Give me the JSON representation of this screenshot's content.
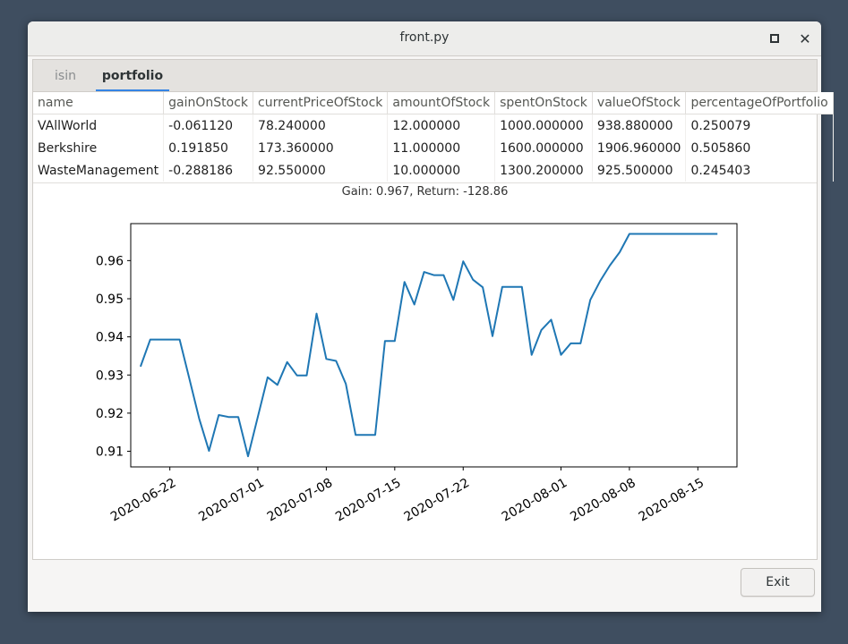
{
  "window": {
    "title": "front.py"
  },
  "tabs": [
    {
      "label": "isin",
      "active": false
    },
    {
      "label": "portfolio",
      "active": true
    }
  ],
  "table": {
    "columns": [
      "name",
      "gainOnStock",
      "currentPriceOfStock",
      "amountOfStock",
      "spentOnStock",
      "valueOfStock",
      "percentageOfPortfolio"
    ],
    "rows": [
      [
        "VAllWorld",
        "-0.061120",
        "78.240000",
        "12.000000",
        "1000.000000",
        "938.880000",
        "0.250079"
      ],
      [
        "Berkshire",
        "0.191850",
        "173.360000",
        "11.000000",
        "1600.000000",
        "1906.960000",
        "0.505860"
      ],
      [
        "WasteManagement",
        "-0.288186",
        "92.550000",
        "10.000000",
        "1300.200000",
        "925.500000",
        "0.245403"
      ]
    ]
  },
  "chart_title": "Gain: 0.967, Return: -128.86",
  "buttons": {
    "exit": "Exit"
  },
  "chart_data": {
    "type": "line",
    "title": "Gain: 0.967, Return: -128.86",
    "xlabel": "",
    "ylabel": "",
    "x_start": "2020-06-18",
    "x_end": "2020-08-19",
    "y_range": [
      0.9059,
      0.9697
    ],
    "grid": false,
    "line_color": "#1f77b4",
    "x_ticks": [
      "2020-06-22",
      "2020-07-01",
      "2020-07-08",
      "2020-07-15",
      "2020-07-22",
      "2020-08-01",
      "2020-08-08",
      "2020-08-15"
    ],
    "y_ticks": [
      0.91,
      0.92,
      0.93,
      0.94,
      0.95,
      0.96
    ],
    "series": [
      {
        "points": [
          [
            "2020-06-19",
            0.9322
          ],
          [
            "2020-06-20",
            0.9393
          ],
          [
            "2020-06-21",
            0.9393
          ],
          [
            "2020-06-22",
            0.9393
          ],
          [
            "2020-06-23",
            0.9393
          ],
          [
            "2020-06-24",
            0.929
          ],
          [
            "2020-06-25",
            0.9186
          ],
          [
            "2020-06-26",
            0.9101
          ],
          [
            "2020-06-27",
            0.9195
          ],
          [
            "2020-06-28",
            0.919
          ],
          [
            "2020-06-29",
            0.919
          ],
          [
            "2020-06-30",
            0.9087
          ],
          [
            "2020-07-01",
            0.9191
          ],
          [
            "2020-07-02",
            0.9294
          ],
          [
            "2020-07-03",
            0.9274
          ],
          [
            "2020-07-04",
            0.9334
          ],
          [
            "2020-07-05",
            0.9299
          ],
          [
            "2020-07-06",
            0.9299
          ],
          [
            "2020-07-07",
            0.9461
          ],
          [
            "2020-07-08",
            0.9342
          ],
          [
            "2020-07-09",
            0.9337
          ],
          [
            "2020-07-10",
            0.9277
          ],
          [
            "2020-07-11",
            0.9143
          ],
          [
            "2020-07-12",
            0.9143
          ],
          [
            "2020-07-13",
            0.9143
          ],
          [
            "2020-07-14",
            0.9389
          ],
          [
            "2020-07-15",
            0.9389
          ],
          [
            "2020-07-16",
            0.9544
          ],
          [
            "2020-07-17",
            0.9485
          ],
          [
            "2020-07-18",
            0.957
          ],
          [
            "2020-07-19",
            0.9562
          ],
          [
            "2020-07-20",
            0.9562
          ],
          [
            "2020-07-21",
            0.9497
          ],
          [
            "2020-07-22",
            0.9598
          ],
          [
            "2020-07-23",
            0.955
          ],
          [
            "2020-07-24",
            0.953
          ],
          [
            "2020-07-25",
            0.9402
          ],
          [
            "2020-07-26",
            0.9531
          ],
          [
            "2020-07-27",
            0.9531
          ],
          [
            "2020-07-28",
            0.9531
          ],
          [
            "2020-07-29",
            0.9353
          ],
          [
            "2020-07-30",
            0.9418
          ],
          [
            "2020-07-31",
            0.9445
          ],
          [
            "2020-08-01",
            0.9353
          ],
          [
            "2020-08-02",
            0.9383
          ],
          [
            "2020-08-03",
            0.9383
          ],
          [
            "2020-08-04",
            0.9497
          ],
          [
            "2020-08-05",
            0.9546
          ],
          [
            "2020-08-06",
            0.9587
          ],
          [
            "2020-08-07",
            0.9622
          ],
          [
            "2020-08-08",
            0.967
          ],
          [
            "2020-08-09",
            0.967
          ],
          [
            "2020-08-10",
            0.967
          ],
          [
            "2020-08-11",
            0.967
          ],
          [
            "2020-08-12",
            0.967
          ],
          [
            "2020-08-13",
            0.967
          ],
          [
            "2020-08-14",
            0.967
          ],
          [
            "2020-08-15",
            0.967
          ],
          [
            "2020-08-16",
            0.967
          ],
          [
            "2020-08-17",
            0.967
          ]
        ]
      }
    ]
  }
}
